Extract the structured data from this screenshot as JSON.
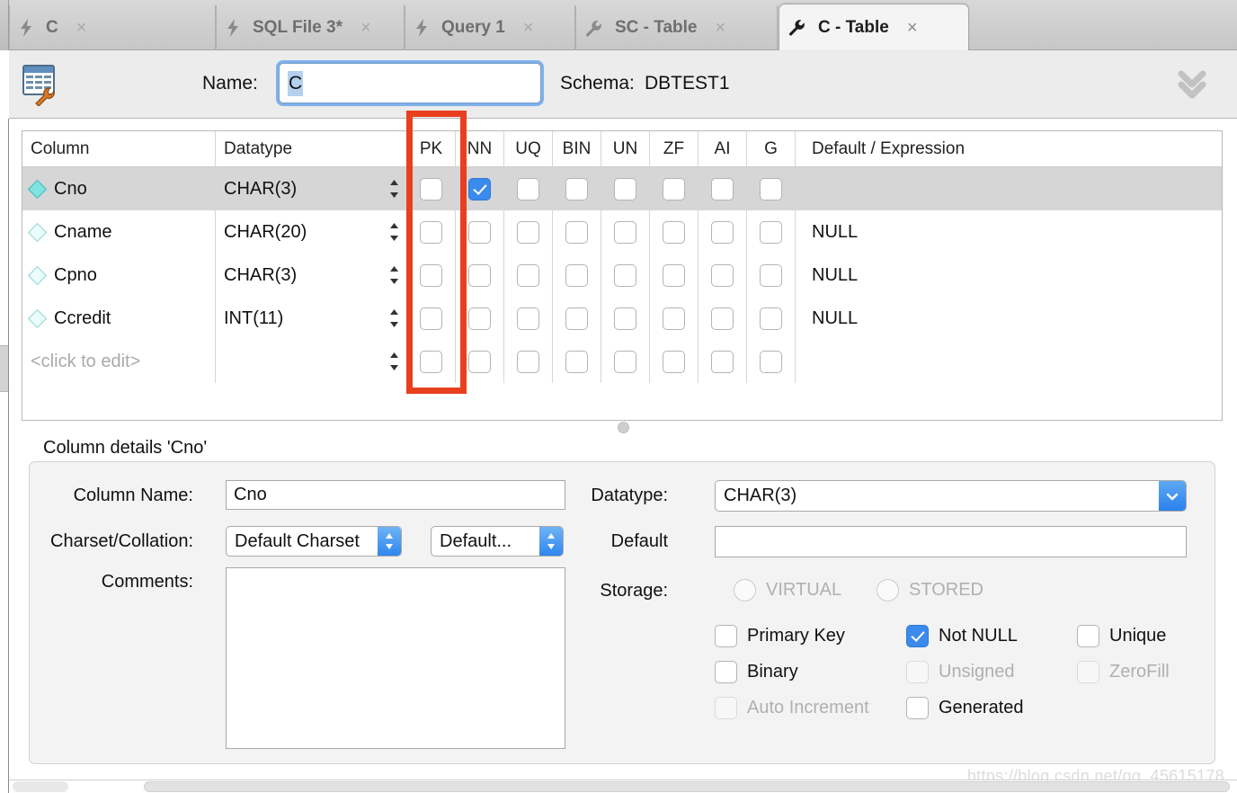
{
  "tabs": [
    {
      "label": "C",
      "icon": "bolt-icon",
      "active": false
    },
    {
      "label": "SQL File 3*",
      "icon": "bolt-icon",
      "active": false
    },
    {
      "label": "Query 1",
      "icon": "bolt-icon",
      "active": false
    },
    {
      "label": "SC - Table",
      "icon": "wrench-icon",
      "active": false
    },
    {
      "label": "C - Table",
      "icon": "wrench-icon",
      "active": true
    }
  ],
  "tab_close_glyph": "×",
  "header": {
    "table_icon": "table-editor-icon",
    "name_label": "Name:",
    "name_value": "C",
    "schema_label": "Schema:",
    "schema_value": "DBTEST1",
    "collapse_icon": "double-chevron-down-icon"
  },
  "grid": {
    "headers": [
      "Column",
      "Datatype",
      "PK",
      "NN",
      "UQ",
      "BIN",
      "UN",
      "ZF",
      "AI",
      "G",
      "Default / Expression"
    ],
    "rows": [
      {
        "column": "Cno",
        "datatype": "CHAR(3)",
        "pk": false,
        "nn": true,
        "uq": false,
        "bin": false,
        "un": false,
        "zf": false,
        "ai": false,
        "g": false,
        "default": "",
        "selected": true,
        "placeholder": false
      },
      {
        "column": "Cname",
        "datatype": "CHAR(20)",
        "pk": false,
        "nn": false,
        "uq": false,
        "bin": false,
        "un": false,
        "zf": false,
        "ai": false,
        "g": false,
        "default": "NULL",
        "selected": false,
        "placeholder": false
      },
      {
        "column": "Cpno",
        "datatype": "CHAR(3)",
        "pk": false,
        "nn": false,
        "uq": false,
        "bin": false,
        "un": false,
        "zf": false,
        "ai": false,
        "g": false,
        "default": "NULL",
        "selected": false,
        "placeholder": false
      },
      {
        "column": "Ccredit",
        "datatype": "INT(11)",
        "pk": false,
        "nn": false,
        "uq": false,
        "bin": false,
        "un": false,
        "zf": false,
        "ai": false,
        "g": false,
        "default": "NULL",
        "selected": false,
        "placeholder": false
      },
      {
        "column": "<click to edit>",
        "datatype": "",
        "pk": false,
        "nn": false,
        "uq": false,
        "bin": false,
        "un": false,
        "zf": false,
        "ai": false,
        "g": false,
        "default": "",
        "selected": false,
        "placeholder": true
      }
    ],
    "annotation_color": "#e8401f",
    "annotation_target": "PK"
  },
  "details": {
    "title": "Column details 'Cno'",
    "column_name_label": "Column Name:",
    "column_name_value": "Cno",
    "charset_label": "Charset/Collation:",
    "charset_value": "Default Charset",
    "collation_value": "Default...",
    "comments_label": "Comments:",
    "comments_value": "",
    "datatype_label": "Datatype:",
    "datatype_value": "CHAR(3)",
    "default_label": "Default",
    "default_value": "",
    "storage_label": "Storage:",
    "storage_options": [
      {
        "label": "VIRTUAL",
        "selected": false,
        "enabled": false
      },
      {
        "label": "STORED",
        "selected": false,
        "enabled": false
      }
    ],
    "flags": [
      {
        "label": "Primary Key",
        "checked": false,
        "enabled": true
      },
      {
        "label": "Not NULL",
        "checked": true,
        "enabled": true
      },
      {
        "label": "Unique",
        "checked": false,
        "enabled": true
      },
      {
        "label": "Binary",
        "checked": false,
        "enabled": true
      },
      {
        "label": "Unsigned",
        "checked": false,
        "enabled": false
      },
      {
        "label": "ZeroFill",
        "checked": false,
        "enabled": false
      },
      {
        "label": "Auto Increment",
        "checked": false,
        "enabled": false
      },
      {
        "label": "Generated",
        "checked": false,
        "enabled": true
      }
    ]
  },
  "watermark": "https://blog.csdn.net/qq_45615178"
}
